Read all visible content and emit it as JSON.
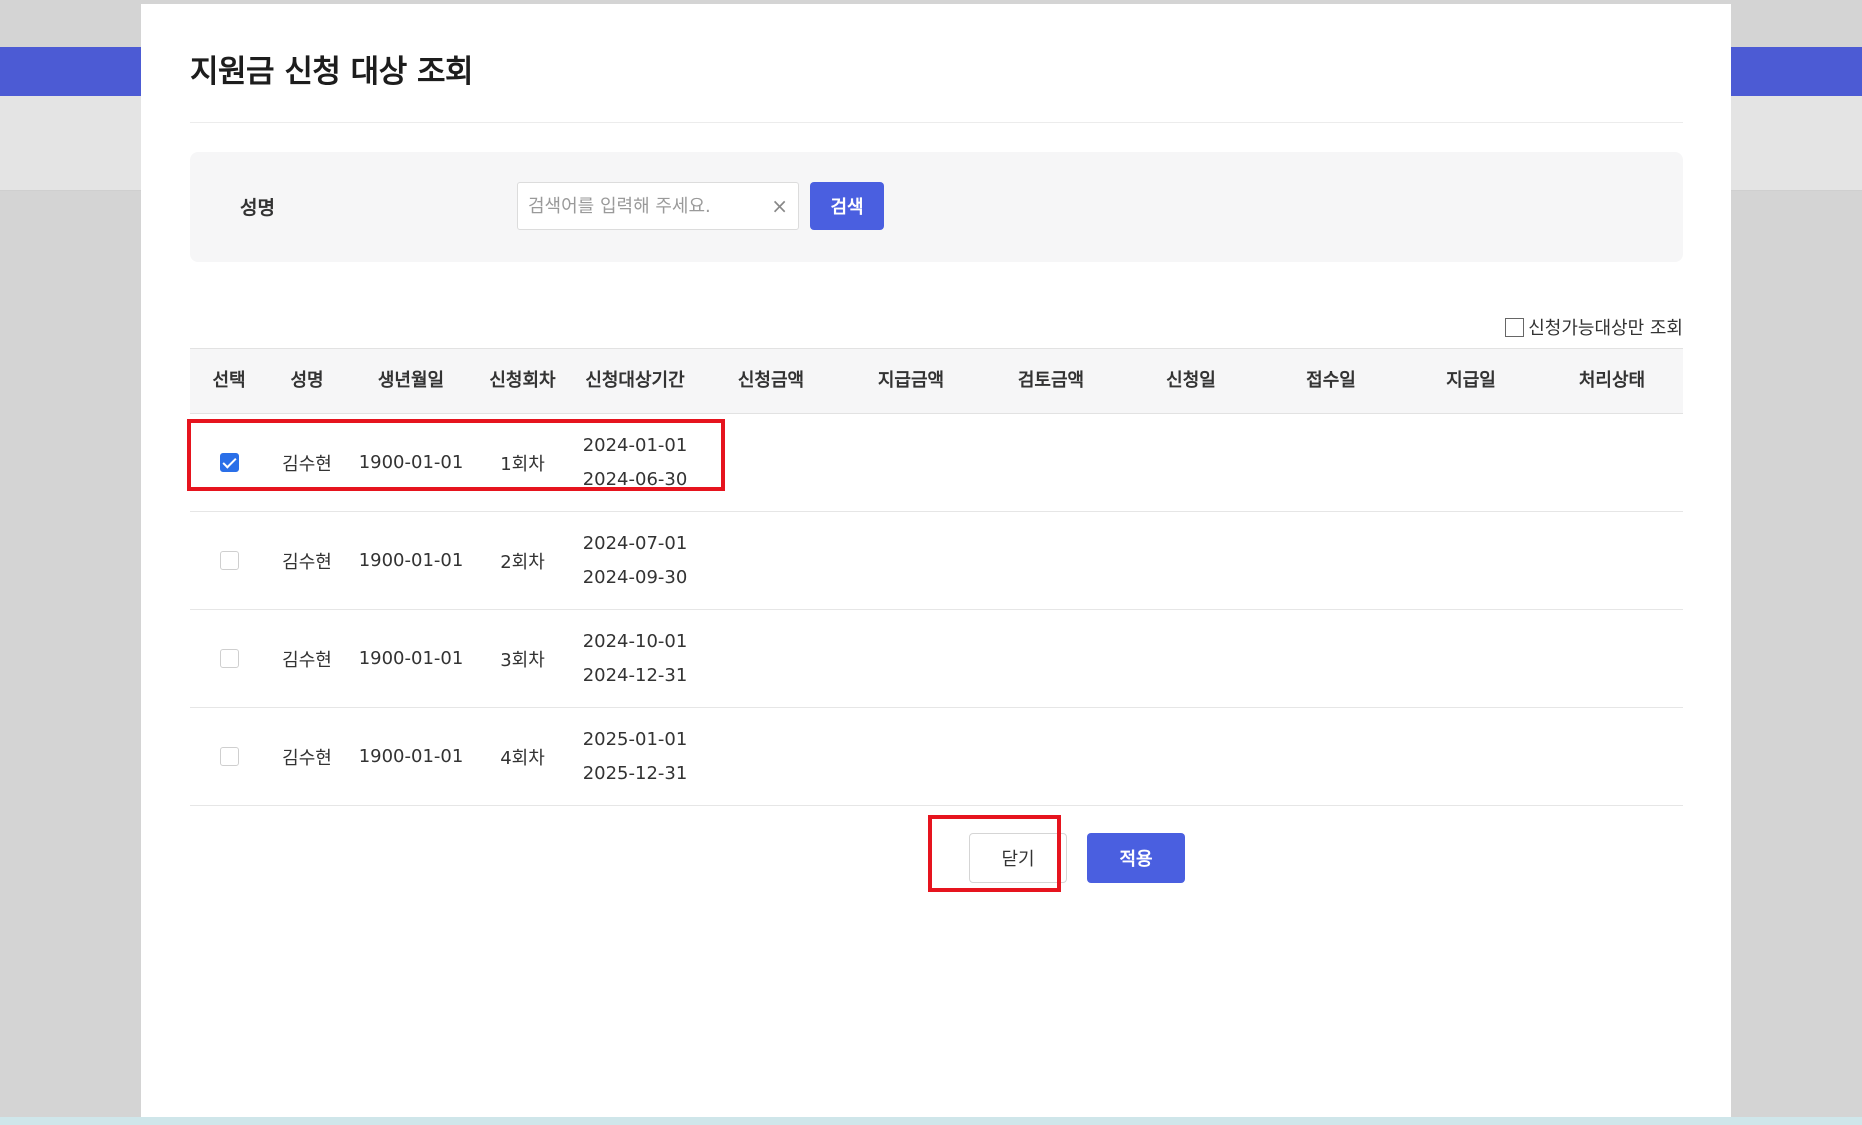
{
  "modal": {
    "title": "지원금 신청 대상 조회"
  },
  "search": {
    "label": "성명",
    "placeholder": "검색어를 입력해 주세요.",
    "value": "",
    "clear_symbol": "×",
    "button_label": "검색"
  },
  "filter": {
    "label": "신청가능대상만 조회",
    "checked": false
  },
  "table": {
    "headers": [
      "선택",
      "성명",
      "생년월일",
      "신청회차",
      "신청대상기간",
      "신청금액",
      "지급금액",
      "검토금액",
      "신청일",
      "접수일",
      "지급일",
      "처리상태"
    ],
    "rows": [
      {
        "selected": true,
        "name": "김수현",
        "birth": "1900-01-01",
        "round": "1회차",
        "period_start": "2024-01-01",
        "period_end": "2024-06-30"
      },
      {
        "selected": false,
        "name": "김수현",
        "birth": "1900-01-01",
        "round": "2회차",
        "period_start": "2024-07-01",
        "period_end": "2024-09-30"
      },
      {
        "selected": false,
        "name": "김수현",
        "birth": "1900-01-01",
        "round": "3회차",
        "period_start": "2024-10-01",
        "period_end": "2024-12-31"
      },
      {
        "selected": false,
        "name": "김수현",
        "birth": "1900-01-01",
        "round": "4회차",
        "period_start": "2025-01-01",
        "period_end": "2025-12-31"
      }
    ]
  },
  "footer": {
    "close_label": "닫기",
    "apply_label": "적용"
  },
  "colors": {
    "accent": "#4a5fe0",
    "checkbox_checked": "#2a6fe8",
    "highlight": "#e6141e",
    "background_band": "#4c5bd4"
  }
}
